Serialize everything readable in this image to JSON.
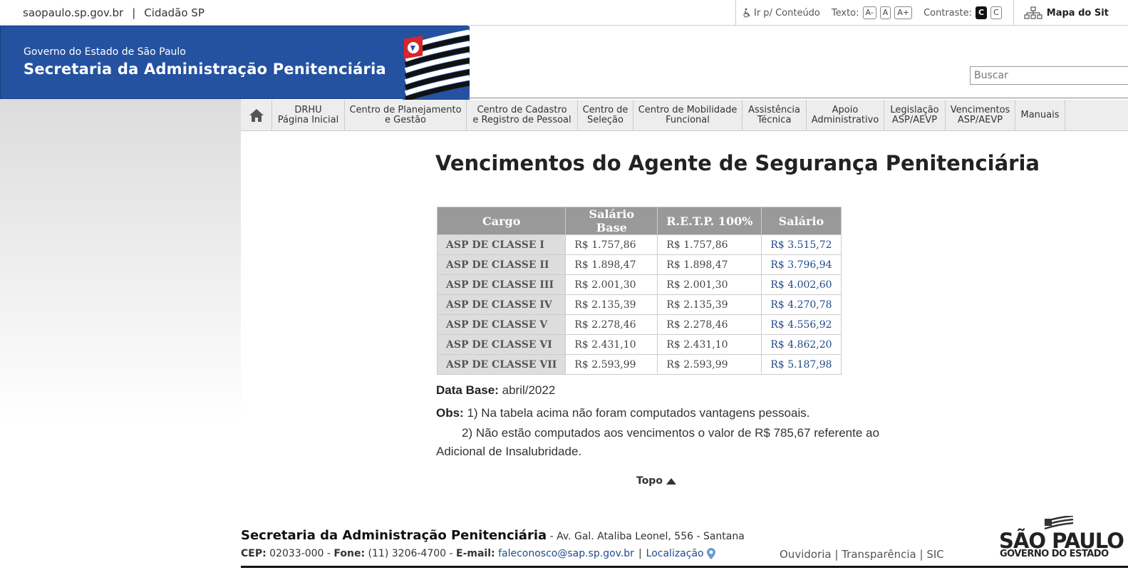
{
  "topbar": {
    "links": [
      "saopaulo.sp.gov.br",
      "Cidadão SP"
    ],
    "skip_content": "Ir p/ Conteúdo",
    "text_label": "Texto:",
    "text_sizes": [
      "A-",
      "A",
      "A+"
    ],
    "contrast_label": "Contraste:",
    "contrast_options": [
      "C",
      "C"
    ],
    "sitemap": "Mapa do Sit"
  },
  "header": {
    "subtitle": "Governo do Estado de São Paulo",
    "title": "Secretaria da Administração Penitenciária"
  },
  "search": {
    "placeholder": "Buscar"
  },
  "nav": {
    "items": [
      {
        "line1": "DRHU",
        "line2": "Página Inicial"
      },
      {
        "line1": "Centro de Planejamento",
        "line2": "e Gestão"
      },
      {
        "line1": "Centro de Cadastro",
        "line2": "e Registro de Pessoal"
      },
      {
        "line1": "Centro de",
        "line2": "Seleção"
      },
      {
        "line1": "Centro de Mobilidade",
        "line2": "Funcional"
      },
      {
        "line1": "Assistência",
        "line2": "Técnica"
      },
      {
        "line1": "Apoio",
        "line2": "Administrativo"
      },
      {
        "line1": "Legislação",
        "line2": "ASP/AEVP"
      },
      {
        "line1": "Vencimentos",
        "line2": "ASP/AEVP"
      },
      {
        "line1": "Manuais",
        "line2": ""
      }
    ]
  },
  "main": {
    "title": "Vencimentos do Agente de Segurança Penitenciária",
    "table": {
      "headers": [
        "Cargo",
        "Salário Base",
        "R.E.T.P. 100%",
        "Salário"
      ],
      "rows": [
        [
          "ASP DE CLASSE I",
          "R$ 1.757,86",
          "R$ 1.757,86",
          "R$ 3.515,72"
        ],
        [
          "ASP DE CLASSE II",
          "R$ 1.898,47",
          "R$ 1.898,47",
          "R$ 3.796,94"
        ],
        [
          "ASP DE CLASSE III",
          "R$ 2.001,30",
          "R$ 2.001,30",
          "R$ 4.002,60"
        ],
        [
          "ASP DE CLASSE IV",
          "R$ 2.135,39",
          "R$ 2.135,39",
          "R$ 4.270,78"
        ],
        [
          "ASP DE CLASSE V",
          "R$ 2.278,46",
          "R$ 2.278,46",
          "R$ 4.556,92"
        ],
        [
          "ASP DE CLASSE VI",
          "R$ 2.431,10",
          "R$ 2.431,10",
          "R$ 4.862,20"
        ],
        [
          "ASP DE CLASSE VII",
          "R$ 2.593,99",
          "R$ 2.593,99",
          "R$ 5.187,98"
        ]
      ]
    },
    "data_base_label": "Data Base:",
    "data_base_value": "abril/2022",
    "obs_label": "Obs:",
    "obs1": "1) Na tabela acima não foram computados vantagens pessoais.",
    "obs2_a": "2) Não estão computados aos vencimentos o valor de R$ 785,67 referente ao",
    "obs2_b": "Adicional de Insalubridade.",
    "topo": "Topo"
  },
  "footer": {
    "org": "Secretaria da Administração Penitenciária",
    "address": " - Av. Gal. Ataliba Leonel, 556 - Santana",
    "cep_label": "CEP:",
    "cep": " 02033-000 - ",
    "fone_label": "Fone:",
    "fone": " (11) 3206-4700 - ",
    "email_label": "E-mail:",
    "email": "faleconosco@sap.sp.gov.br",
    "location": "Localização",
    "links": [
      "Ouvidoria",
      "Transparência",
      "SIC"
    ],
    "logo_line1": "SÃO PAULO",
    "logo_line2": "GOVERNO DO ESTADO"
  },
  "colors": {
    "header_blue": "#2452a0",
    "link_blue": "#1f4a8a",
    "table_header": "#999999"
  }
}
